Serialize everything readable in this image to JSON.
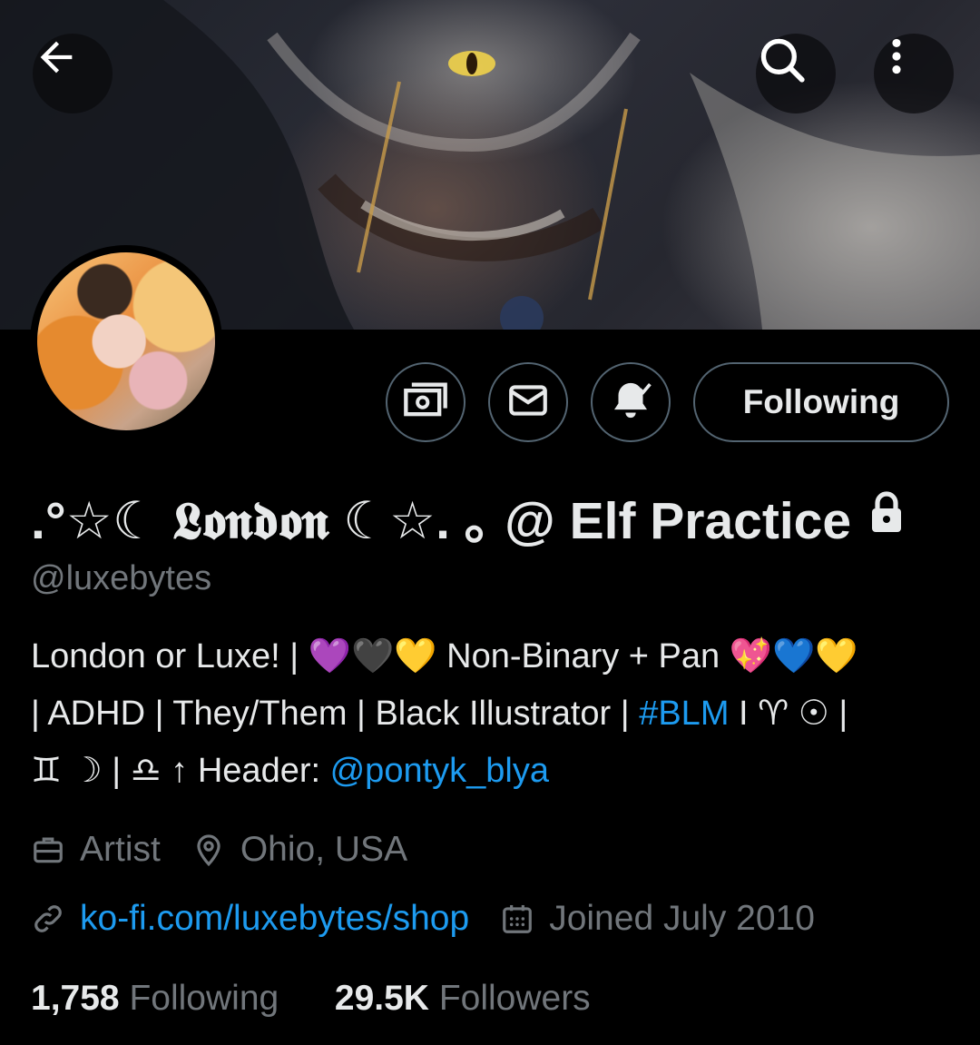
{
  "profile": {
    "display_name": ".°☆☾ 𝕷𝖔𝖓𝖉𝖔𝖓 ☾☆. ｡ @ Elf Practice",
    "handle": "@luxebytes",
    "follow_button": "Following",
    "bio": {
      "line1": "London or Luxe! | 💜🖤💛 Non-Binary + Pan 💖💙💛",
      "line2_prefix": "| ADHD | They/Them | Black Illustrator | ",
      "line2_link": "#BLM",
      "line2_suffix": " I ♈ ☉ |",
      "line3_prefix": "♊ ☽ | ♎ ↑ Header: ",
      "line3_link": "@pontyk_blya"
    },
    "profession": "Artist",
    "location": "Ohio, USA",
    "website": "ko-fi.com/luxebytes/shop",
    "joined": "Joined July 2010",
    "following_count": "1,758",
    "following_label": "Following",
    "followers_count": "29.5K",
    "followers_label": "Followers"
  },
  "icons": {
    "back": "back-arrow-icon",
    "search": "search-icon",
    "more": "more-vertical-icon",
    "tip": "money-icon",
    "message": "envelope-icon",
    "notify": "bell-subscribed-icon",
    "protected": "lock-icon",
    "profession": "briefcase-icon",
    "location": "location-pin-icon",
    "website": "link-icon",
    "joined": "calendar-icon"
  },
  "colors": {
    "background": "#000000",
    "text": "#e7e9ea",
    "secondary": "#71767b",
    "link": "#1d9bf0",
    "border": "#536471"
  }
}
